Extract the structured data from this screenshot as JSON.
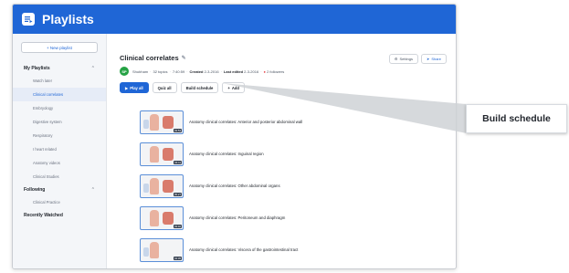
{
  "app": {
    "title": "Playlists"
  },
  "sidebar": {
    "new_playlist": "+ New playlist",
    "sections": [
      {
        "label": "My Playlists",
        "expanded": true,
        "items": [
          "Watch later",
          "Clinical correlates",
          "Embryology",
          "Digestive system",
          "Respiratory",
          "I heart related",
          "Anatomy videos",
          "Clinical Studies"
        ]
      },
      {
        "label": "Following",
        "expanded": true,
        "items": [
          "Clinical Practice"
        ]
      },
      {
        "label": "Recently Watched",
        "expanded": false,
        "items": []
      }
    ],
    "active_item": "Clinical correlates"
  },
  "playlist": {
    "title": "Clinical correlates",
    "owner_initials": "SP",
    "owner": "Shubham",
    "topics": "32 topics",
    "duration": "7:40:59",
    "created_label": "Created",
    "created": "2-3-2016",
    "last_edited_label": "Last edited",
    "last_edited": "2-3-2016",
    "followers": "2 followers"
  },
  "top_actions": {
    "settings": "Settings",
    "share": "Share"
  },
  "actions": {
    "play_all": "Play all",
    "quiz_all": "Quiz all",
    "build_schedule": "Build schedule",
    "add": "Add"
  },
  "videos": [
    {
      "title": "Anatomy clinical correlates: Anterior and posterior abdominal wall",
      "duration": "03:53"
    },
    {
      "title": "Anatomy clinical correlates: Inguinal region",
      "duration": "04:11"
    },
    {
      "title": "Anatomy clinical correlates: Other abdominal organs",
      "duration": "05:27"
    },
    {
      "title": "Anatomy clinical correlates: Peritoneum and diaphragm",
      "duration": "03:40"
    },
    {
      "title": "Anatomy clinical correlates: Viscera of the gastrointestinal tract",
      "duration": "04:05"
    }
  ],
  "callout": {
    "label": "Build schedule"
  },
  "colors": {
    "accent": "#1f66d6",
    "avatar": "#25a244",
    "sidebar_bg": "#f4f6f9"
  }
}
